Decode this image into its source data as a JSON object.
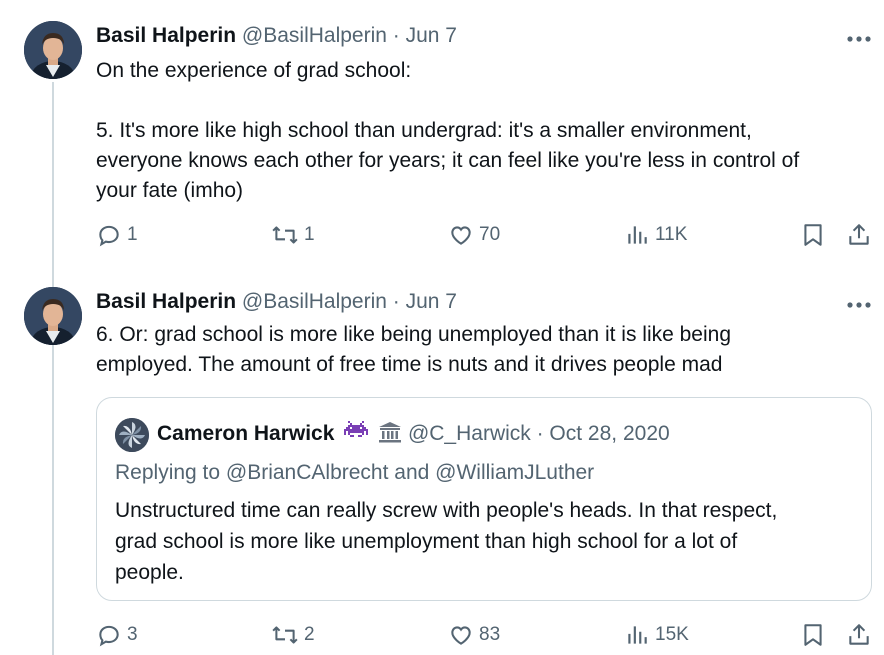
{
  "tweets": [
    {
      "author_name": "Basil Halperin",
      "handle_date": "@BasilHalperin · Jun 7",
      "lines": [
        "On the experience of grad school:",
        "",
        "5. It's more like high school than undergrad: it's a smaller environment,",
        "everyone knows each other for years; it can feel like you're less in control of",
        "your fate (imho)"
      ],
      "replies": "1",
      "retweets": "1",
      "likes": "70",
      "views": "11K"
    },
    {
      "author_name": "Basil Halperin",
      "handle_date": "@BasilHalperin · Jun 7",
      "lines": [
        "6. Or: grad school is more like being unemployed than it is like being",
        "employed. The amount of free time is nuts and it drives people mad"
      ],
      "replies": "3",
      "retweets": "2",
      "likes": "83",
      "views": "15K"
    }
  ],
  "quote": {
    "author_name": "Cameron Harwick",
    "handle_date": "@C_Harwick · Oct 28, 2020",
    "replying_to": "Replying to @BrianCAlbrecht and @WilliamJLuther",
    "lines": [
      "Unstructured time can really screw with people's heads. In that respect,",
      "grad school is more like unemployment than high school for a lot of",
      "people."
    ]
  },
  "icons": {
    "more": "more-horizontal-icon",
    "reply": "reply-bubble-icon",
    "retweet": "retweet-icon",
    "like": "heart-icon",
    "views": "views-bar-chart-icon",
    "bookmark": "bookmark-icon",
    "share": "share-upload-icon",
    "badge_1": "alien-monster-icon",
    "badge_2": "bank-building-icon"
  },
  "colors": {
    "text": "#0f1419",
    "secondary": "#536471",
    "border": "#cfd9de",
    "badge_purple": "#7a3fb5"
  }
}
